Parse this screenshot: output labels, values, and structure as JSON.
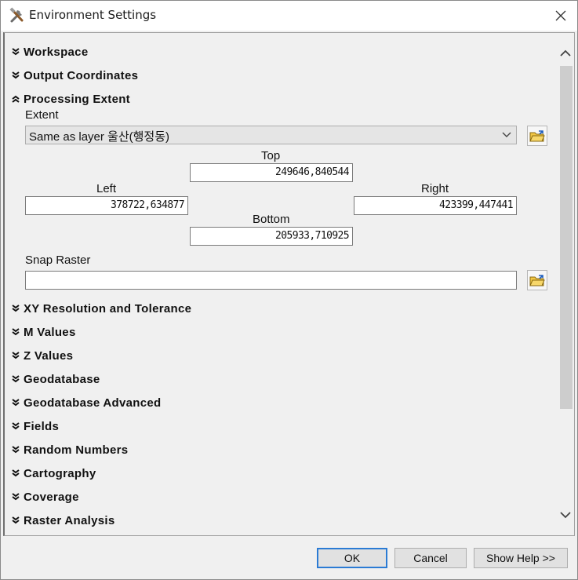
{
  "window": {
    "title": "Environment Settings"
  },
  "sections_top": [
    {
      "label": "Workspace",
      "state": "collapsed"
    },
    {
      "label": "Output Coordinates",
      "state": "collapsed"
    },
    {
      "label": "Processing Extent",
      "state": "expanded"
    }
  ],
  "processing_extent": {
    "extent_label": "Extent",
    "extent_value": "Same as layer 울산(행정동)",
    "top_label": "Top",
    "top_value": "249646,840544",
    "left_label": "Left",
    "left_value": "378722,634877",
    "right_label": "Right",
    "right_value": "423399,447441",
    "bottom_label": "Bottom",
    "bottom_value": "205933,710925",
    "snap_raster_label": "Snap Raster",
    "snap_raster_value": ""
  },
  "sections_bottom": [
    {
      "label": "XY Resolution and Tolerance"
    },
    {
      "label": "M Values"
    },
    {
      "label": "Z Values"
    },
    {
      "label": "Geodatabase"
    },
    {
      "label": "Geodatabase Advanced"
    },
    {
      "label": "Fields"
    },
    {
      "label": "Random Numbers"
    },
    {
      "label": "Cartography"
    },
    {
      "label": "Coverage"
    },
    {
      "label": "Raster Analysis"
    }
  ],
  "buttons": {
    "ok": "OK",
    "cancel": "Cancel",
    "show_help": "Show Help >>"
  },
  "icons": {
    "title": "tools-icon",
    "close": "close-icon",
    "collapsed": "double-chevron-down-icon",
    "expanded": "double-chevron-up-icon",
    "browse": "folder-browse-icon"
  },
  "colors": {
    "default_button_border": "#2b7bd4",
    "scroll_thumb": "#cdcdcd",
    "folder_yellow": "#f2c744"
  }
}
